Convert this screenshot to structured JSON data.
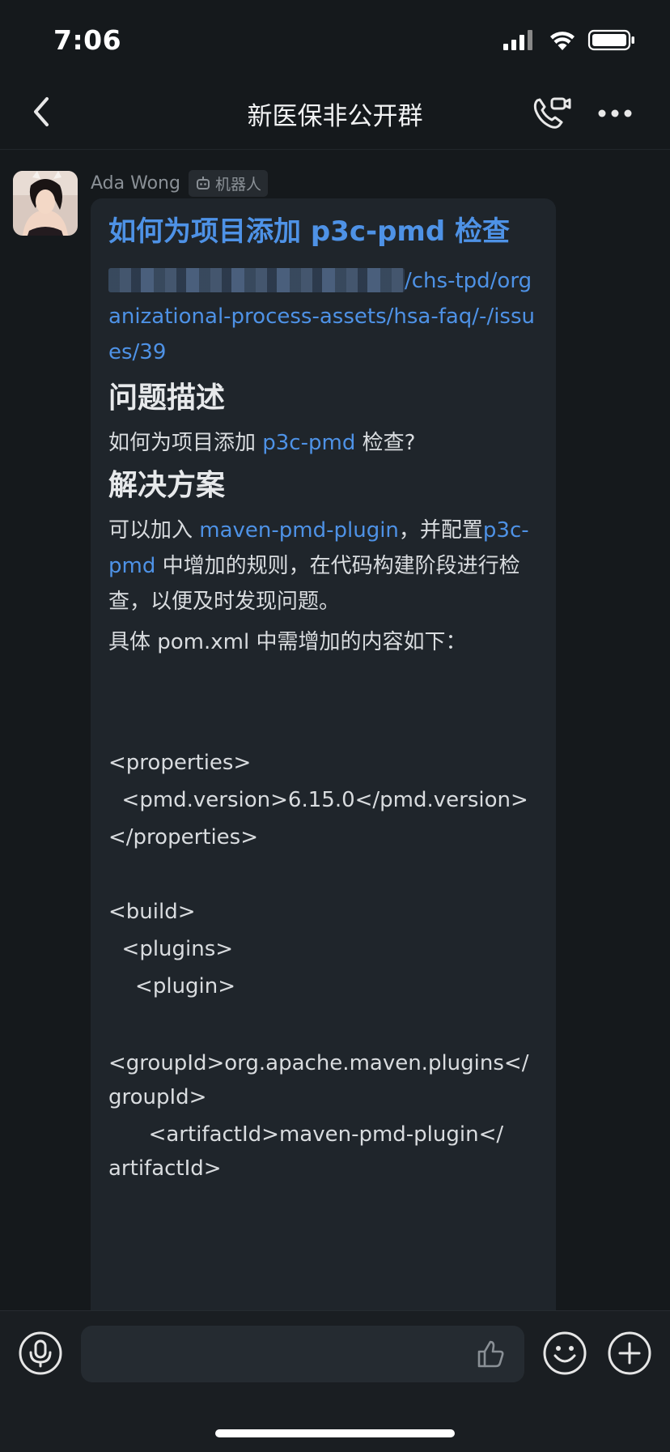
{
  "status": {
    "time": "7:06"
  },
  "nav": {
    "title": "新医保非公开群"
  },
  "message": {
    "sender": "Ada Wong",
    "badge": "机器人",
    "title": "如何为项目添加 p3c-pmd 检查",
    "url_tail": "/chs-tpd/organizational-process-assets/hsa-faq/-/issues/39",
    "section1": {
      "heading": "问题描述",
      "text_before": "如何为项目添加 ",
      "link": "p3c-pmd",
      "text_after": " 检查?"
    },
    "section2": {
      "heading": "解决方案",
      "t1": "可以加入 ",
      "link1": "maven-pmd-plugin",
      "t2": "，并配置",
      "link2": "p3c-pmd",
      "t3": " 中增加的规则，在代码构建阶段进行检查，以便及时发现问题。"
    },
    "intro": "具体 pom.xml 中需增加的内容如下：",
    "code_lines": [
      "<properties>",
      "  <pmd.version>6.15.0</pmd.version>",
      "</properties>",
      "",
      "<build>",
      "  <plugins>",
      "    <plugin>",
      "",
      "<groupId>org.apache.maven.plugins</",
      "groupId>",
      "      <artifactId>maven-pmd-plugin</",
      "artifactId>"
    ]
  },
  "icons": [
    "back-icon",
    "phone-call-icon",
    "more-icon",
    "robot-icon",
    "mic-icon",
    "thumbs-up-icon",
    "emoji-icon",
    "plus-icon"
  ]
}
